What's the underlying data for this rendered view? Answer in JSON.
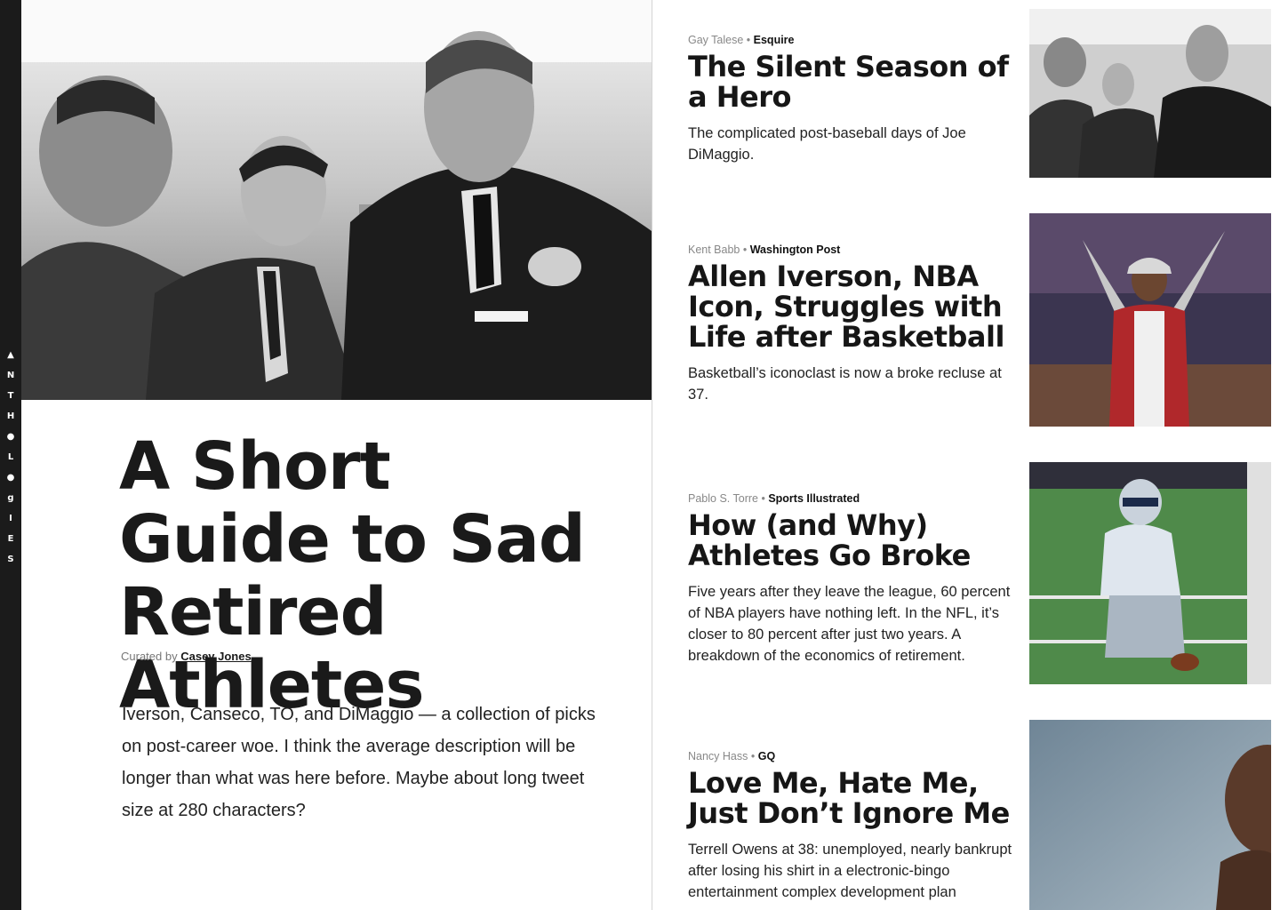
{
  "rail": {
    "letters": [
      "▲",
      "N",
      "T",
      "H",
      "●",
      "L",
      "●",
      "g",
      "I",
      "E",
      "S"
    ]
  },
  "feature": {
    "title": "A Short Guide to Sad Retired Athletes",
    "curated_prefix": "Curated by",
    "curator": "Casey Jones",
    "description": "Iverson, Canseco, TO, and DiMaggio — a collection of picks on post-career woe. I think the average description will be longer than what was here before. Maybe about long tweet size at 280 characters?"
  },
  "stories": [
    {
      "author": "Gay Talese",
      "publication": "Esquire",
      "title": "The Silent Season of a Hero",
      "description": "The complicated post-baseball days of Joe DiMaggio."
    },
    {
      "author": "Kent Babb",
      "publication": "Washington Post",
      "title": "Allen Iverson, NBA Icon, Struggles with Life after Basketball",
      "description": "Basketball’s iconoclast is now a broke recluse at 37."
    },
    {
      "author": "Pablo S. Torre",
      "publication": "Sports Illustrated",
      "title": "How (and Why) Athletes Go Broke",
      "description": "Five years after they leave the league, 60 percent of NBA players have nothing left. In the NFL, it’s closer to 80 percent after just two years. A breakdown of the economics of retirement."
    },
    {
      "author": "Nancy Hass",
      "publication": "GQ",
      "title": "Love Me, Hate Me, Just Don’t Ignore Me",
      "description": "Terrell Owens at 38: unemployed, nearly bankrupt after losing his shirt in a electronic-bingo entertainment complex development plan"
    }
  ],
  "separator": " • ",
  "colors": {
    "rail": "#1b1b1b",
    "text": "#1a1a1a",
    "muted": "#888888"
  }
}
